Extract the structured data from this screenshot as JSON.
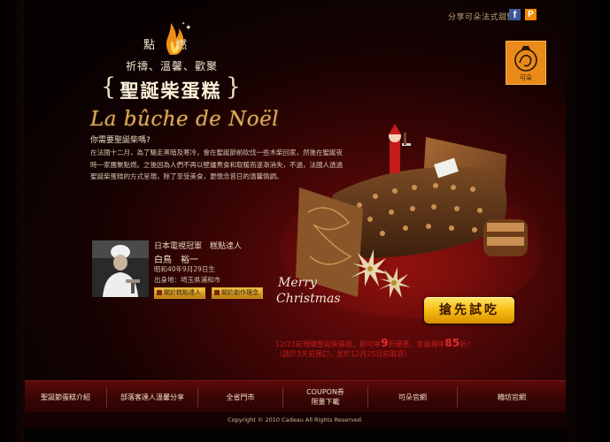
{
  "share": {
    "text": "分享可朵法式甜點",
    "facebook_icon": "facebook-icon",
    "plurk_icon": "plurk-icon"
  },
  "brand": {
    "logo_icon": "cadeau-logo-icon",
    "logo_caption": "可朵",
    "accent_color": "#e98a1a"
  },
  "hero": {
    "kai_left": "點",
    "kai_right": "燃",
    "subheading": "祈禱、溫馨、歡聚",
    "title": "聖誕柴蛋糕",
    "script_title": "La bûche de Noël",
    "intro_question": "你需要聖誕柴嗎?",
    "paragraph": "在法國十二月，為了驅走黑暗及寒冷，會在聖誕節前砍伐一些木柴回家，然後在聖誕夜時一家團聚點燃。之後因為人們不再以壁爐煮食和取暖而逐漸消失，不過，法國人透過聖誕柴蛋糕的方式呈現，除了享受美食，更懷念昔日的溫馨情調。"
  },
  "chef": {
    "title": "日本電視冠軍　糕點達人",
    "name": "白鳥　裕一",
    "birth": "昭和40年9月29日生",
    "birthplace": "出身地：埼玉県浦和市",
    "chip1": "關於糕點達人",
    "chip2": "關於創作理念"
  },
  "cta": {
    "try_label": "搶先試吃",
    "promo_line1_pre": "12/21前預購聖誕柴蛋糕，即可享",
    "promo_line1_big1": "9",
    "promo_line1_mid": "折優惠，會員獨享",
    "promo_line1_big2": "85",
    "promo_line1_post": "折！",
    "promo_line2": "（請於3天前預訂，並於12月25日前取貨）",
    "promo_color": "#c21c1c"
  },
  "cake_image": {
    "caption_merry": "Merry",
    "caption_christmas": "Christmas"
  },
  "nav": {
    "items": [
      "聖誕節蛋糕介紹",
      "部落客達人溫馨分享",
      "全省門市",
      "COUPON券\n限量下載",
      "可朵官網",
      "糟坊官網"
    ]
  },
  "footer": {
    "copyright": "Copyright © 2010 Cadeau All Rights Reserved."
  }
}
